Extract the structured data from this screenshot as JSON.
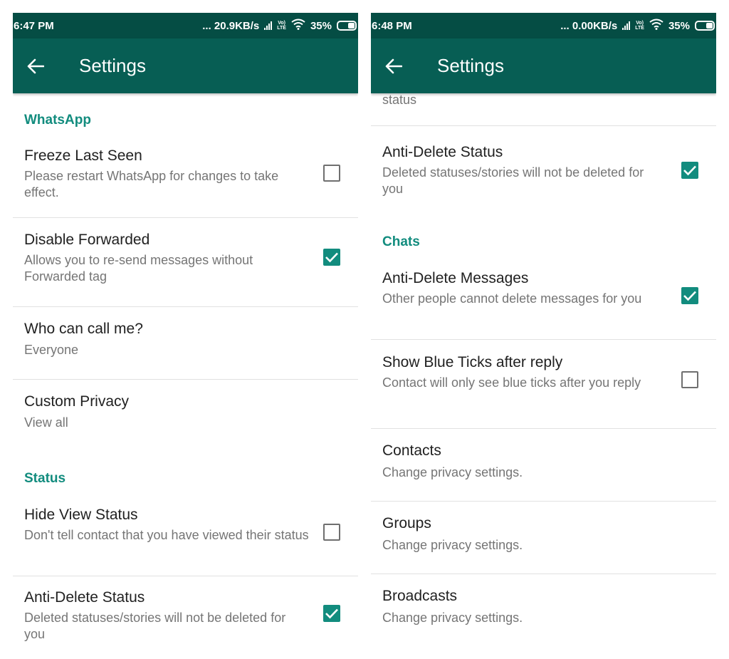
{
  "left_screen": {
    "status_bar": {
      "time": "6:47 PM",
      "net_speed": "... 20.9KB/s",
      "lte_top": "Vo)",
      "lte_bottom": "LTE",
      "battery": "35%"
    },
    "app_bar": {
      "title": "Settings",
      "back_icon": "arrow-left-icon"
    },
    "sections": {
      "whatsapp": "WhatsApp",
      "status": "Status"
    },
    "items": {
      "freeze_last_seen": {
        "title": "Freeze Last Seen",
        "summary": "Please restart WhatsApp for changes to take effect.",
        "checked": false
      },
      "disable_forwarded": {
        "title": "Disable Forwarded",
        "summary": "Allows you to re-send messages without Forwarded tag",
        "checked": true
      },
      "who_can_call": {
        "title": "Who can call me?",
        "summary": "Everyone"
      },
      "custom_privacy": {
        "title": "Custom Privacy",
        "summary": "View all"
      },
      "hide_view_status": {
        "title": "Hide View Status",
        "summary": "Don't tell contact that you have viewed their status",
        "checked": false
      },
      "anti_delete_status": {
        "title": "Anti-Delete Status",
        "summary": "Deleted statuses/stories will not be deleted for you",
        "checked": true
      }
    }
  },
  "right_screen": {
    "status_bar": {
      "time": "6:48 PM",
      "net_speed": "... 0.00KB/s",
      "lte_top": "Vo)",
      "lte_bottom": "LTE",
      "battery": "35%"
    },
    "app_bar": {
      "title": "Settings",
      "back_icon": "arrow-left-icon"
    },
    "cut_text": "status",
    "sections": {
      "chats": "Chats"
    },
    "items": {
      "anti_delete_status": {
        "title": "Anti-Delete Status",
        "summary": "Deleted statuses/stories will not be deleted for you",
        "checked": true
      },
      "anti_delete_messages": {
        "title": "Anti-Delete Messages",
        "summary": "Other people cannot delete messages for you",
        "checked": true
      },
      "blue_ticks": {
        "title": "Show Blue Ticks after reply",
        "summary": "Contact will only see blue ticks after you reply",
        "checked": false
      },
      "contacts": {
        "title": "Contacts",
        "summary": "Change privacy settings."
      },
      "groups": {
        "title": "Groups",
        "summary": "Change privacy settings."
      },
      "broadcasts": {
        "title": "Broadcasts",
        "summary": "Change privacy settings."
      }
    }
  },
  "colors": {
    "status_bar": "#054d44",
    "app_bar": "#075e54",
    "accent": "#128c7e",
    "summary_text": "#757575"
  }
}
